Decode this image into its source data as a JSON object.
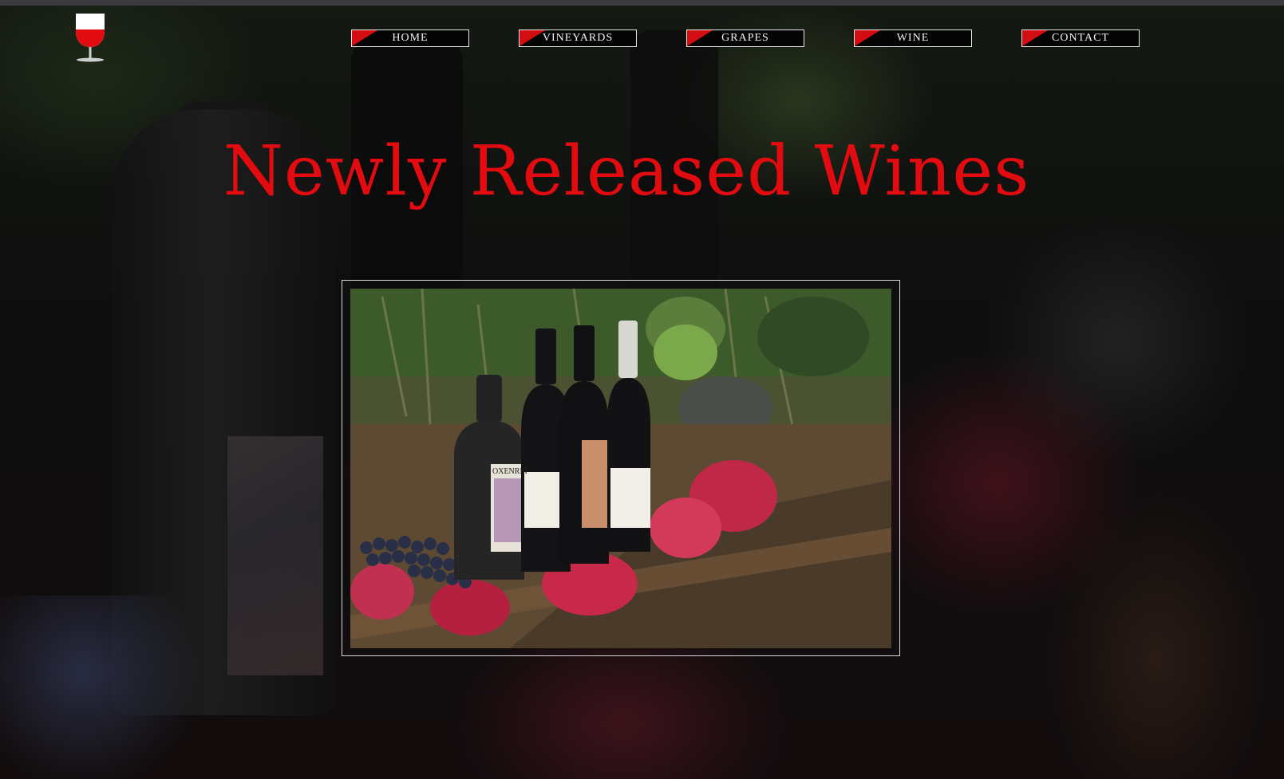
{
  "nav": {
    "items": [
      {
        "label": "HOME"
      },
      {
        "label": "VINEYARDS"
      },
      {
        "label": "GRAPES"
      },
      {
        "label": "WINE"
      },
      {
        "label": "CONTACT"
      }
    ]
  },
  "hero": {
    "title": "Newly Released Wines"
  },
  "photo": {
    "label_brand": "OXENREI"
  },
  "icons": {
    "logo": "wine-glass-icon"
  },
  "colors": {
    "accent": "#e10b10",
    "nav_border": "#e8e8e8",
    "background": "#0b0b0b"
  }
}
